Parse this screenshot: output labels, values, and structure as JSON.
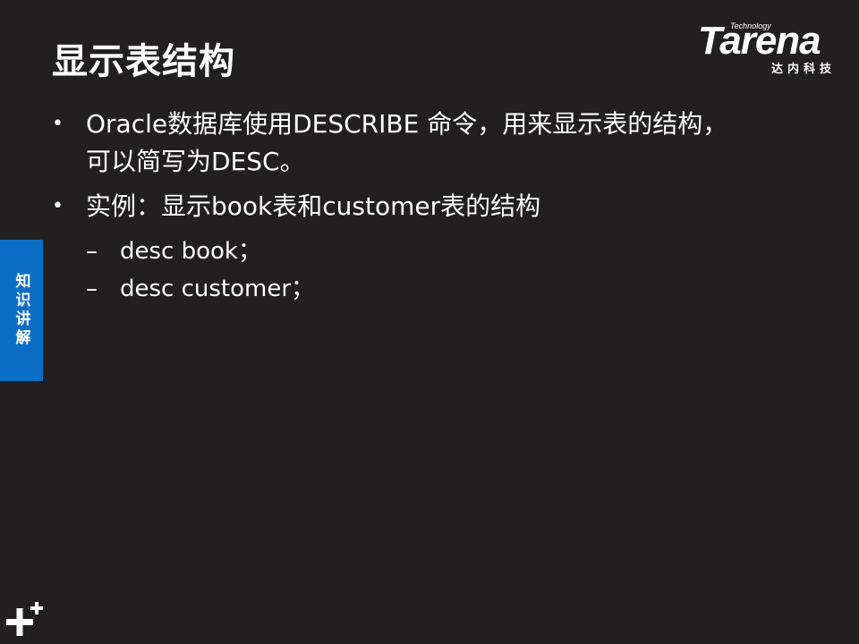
{
  "title": "显示表结构",
  "logo": {
    "technology": "Technology",
    "wordmark": "Tarena",
    "subtitle": "达内科技"
  },
  "bullets": [
    {
      "text": "Oracle数据库使用DESCRIBE 命令，用来显示表的结构，",
      "continuation": "可以简写为DESC。"
    },
    {
      "text": "实例：显示book表和customer表的结构",
      "sub_items": [
        "desc book；",
        "desc customer；"
      ]
    }
  ],
  "side_tab": "知识讲解",
  "bullet_glyph": "•",
  "dash_glyph": "–",
  "icons": [
    "plus-icon"
  ],
  "colors": {
    "background": "#231f20",
    "side_tab": "#0a6ec5",
    "text": "#ffffff"
  }
}
